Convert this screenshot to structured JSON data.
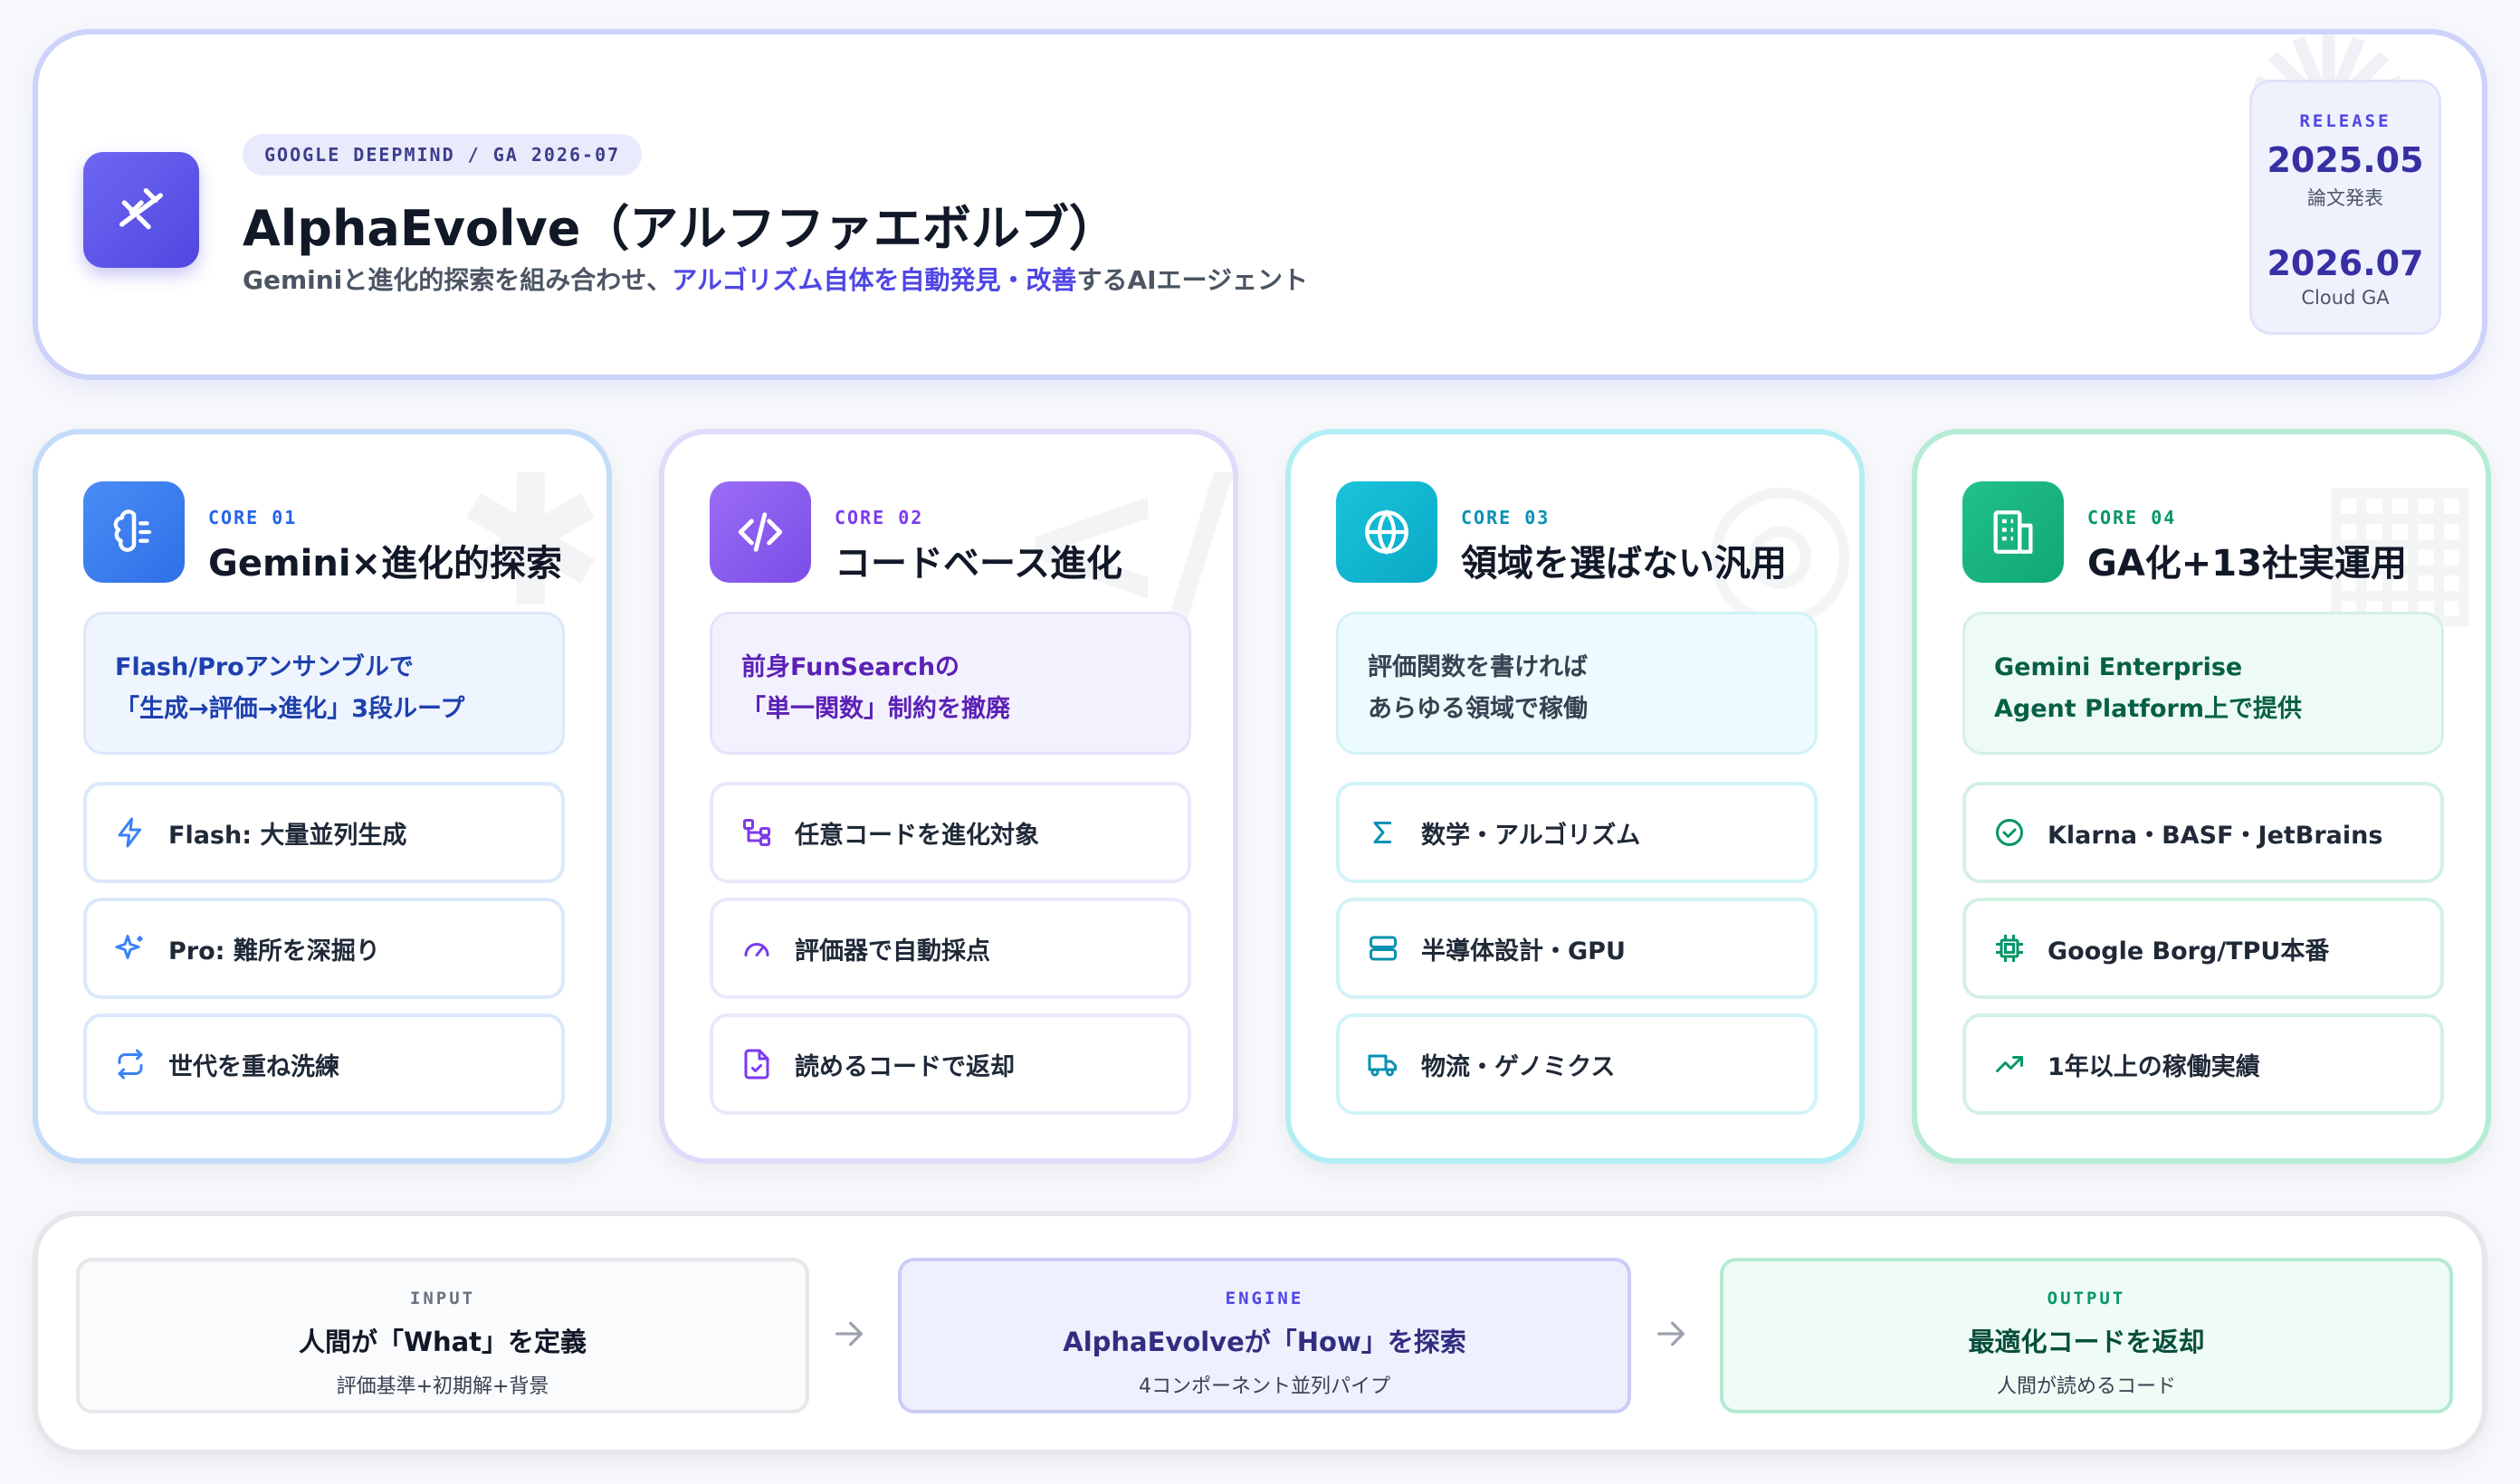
{
  "header": {
    "tag": "GOOGLE DEEPMIND / GA 2026-07",
    "title": "AlphaEvolve（アルフファエボルブ）",
    "subtitle_pre": "Geminiと進化的探索を組み合わせ、",
    "subtitle_highlight": "アルゴリズム自体を自動発見・改善",
    "subtitle_post": "するAIエージェント",
    "icon": "dna-icon"
  },
  "release": {
    "label": "RELEASE",
    "date1": "2025.05",
    "sub1": "論文発表",
    "date2": "2026.07",
    "sub2": "Cloud GA"
  },
  "cards": [
    {
      "core": "CORE 01",
      "title": "Gemini×進化的探索",
      "icon": "brain-icon",
      "highlight_line1": "Flash/Proアンサンブルで",
      "highlight_line2": "「生成→評価→進化」3段ループ",
      "features": [
        {
          "label": "Flash: 大量並列生成",
          "icon": "lightning-icon"
        },
        {
          "label": "Pro: 難所を深掘り",
          "icon": "sparkles-icon"
        },
        {
          "label": "世代を重ね洗練",
          "icon": "repeat-icon"
        }
      ]
    },
    {
      "core": "CORE 02",
      "title": "コードベース進化",
      "icon": "code-icon",
      "highlight_line1": "前身FunSearchの",
      "highlight_line2": "「単一関数」制約を撤廃",
      "features": [
        {
          "label": "任意コードを進化対象",
          "icon": "tree-icon"
        },
        {
          "label": "評価器で自動採点",
          "icon": "gauge-icon"
        },
        {
          "label": "読めるコードで返却",
          "icon": "file-check-icon"
        }
      ]
    },
    {
      "core": "CORE 03",
      "title": "領域を選ばない汎用",
      "icon": "globe-icon",
      "highlight_line1": "評価関数を書ければ",
      "highlight_line2": "あらゆる領域で稼働",
      "features": [
        {
          "label": "数学・アルゴリズム",
          "icon": "sigma-icon"
        },
        {
          "label": "半導体設計・GPU",
          "icon": "server-icon"
        },
        {
          "label": "物流・ゲノミクス",
          "icon": "truck-icon"
        }
      ]
    },
    {
      "core": "CORE 04",
      "title": "GA化+13社実運用",
      "icon": "building-icon",
      "highlight_line1": "Gemini Enterprise",
      "highlight_line2": "Agent Platform上で提供",
      "features": [
        {
          "label": "Klarna・BASF・JetBrains",
          "icon": "check-circle-icon"
        },
        {
          "label": "Google Borg/TPU本番",
          "icon": "chip-icon"
        },
        {
          "label": "1年以上の稼働実績",
          "icon": "trending-up-icon"
        }
      ]
    }
  ],
  "pipeline": [
    {
      "label": "INPUT",
      "main": "人間が「What」を定義",
      "sub": "評価基準+初期解+背景"
    },
    {
      "label": "ENGINE",
      "main": "AlphaEvolveが「How」を探索",
      "sub": "4コンポーネント並列パイプ"
    },
    {
      "label": "OUTPUT",
      "main": "最適化コードを返却",
      "sub": "人間が読めるコード"
    }
  ],
  "colors": {
    "accent": "#4f46e5",
    "core1": "#2563eb",
    "core2": "#7c3aed",
    "core3": "#0891b2",
    "core4": "#059669"
  }
}
